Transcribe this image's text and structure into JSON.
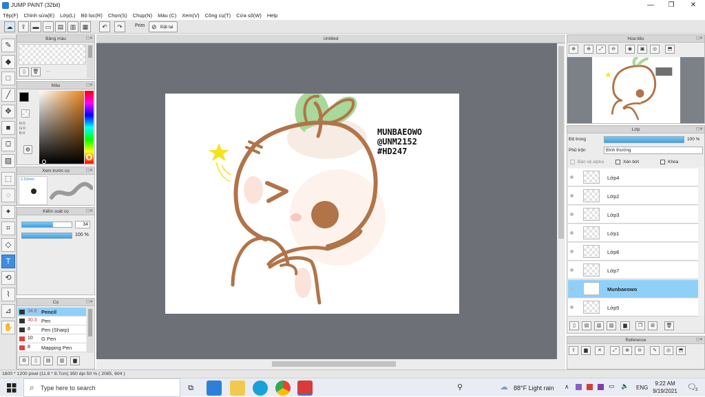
{
  "window": {
    "title": "JUMP PAINT (32bit)",
    "min": "—",
    "max": "❐",
    "close": "✕"
  },
  "menu": [
    "Tệp(F)",
    "Chỉnh sửa(E)",
    "Lớp(L)",
    "Bộ lọc(R)",
    "Chọn(S)",
    "Chụp(N)",
    "Màu (C)",
    "Xem(V)",
    "Công cụ(T)",
    "Cửa sổ(W)",
    "Help"
  ],
  "toolbar": {
    "prim_label": "Prim",
    "reset_label": "Đặt lại"
  },
  "panels": {
    "palette": {
      "title": "Bảng màu",
      "hint": "---"
    },
    "color": {
      "title": "Màu",
      "r": "R:0",
      "g": "G:0",
      "b": "B:0",
      "current": "#000000"
    },
    "preview": {
      "title": "Xem trước cọ",
      "size": "2.53mm"
    },
    "control": {
      "title": "Kiểm soát cọ",
      "size_value": "34",
      "opacity_value": "100 %"
    },
    "brushes": {
      "title": "Cọ",
      "items": [
        {
          "size": "34.6",
          "name": "Pencil",
          "color": "#333333"
        },
        {
          "size": "30.3",
          "name": "Pen",
          "color": "#333333"
        },
        {
          "size": "8",
          "name": "Pen (Sharp)",
          "color": "#333333"
        },
        {
          "size": "10",
          "name": "G Pen",
          "color": "#e04040"
        },
        {
          "size": "8",
          "name": "Mapping Pen",
          "color": "#e04040"
        }
      ]
    },
    "navigator": {
      "title": "Hoa tiêu"
    },
    "layers": {
      "title": "Lớp",
      "opacity_label": "Độ trong",
      "opacity_value": "100 %",
      "opacity_fraction": 1.0,
      "blend_label": "Phủ trộn",
      "blend_value": "Bình thường",
      "protect_alpha": "Bảo vệ alpha",
      "clip": "Xén bớt",
      "lock": "Khóa",
      "items": [
        "Lớp4",
        "Lớp2",
        "Lớp3",
        "Lớp1",
        "Lớp6",
        "Lớp7",
        "Munbaeowo",
        "Lớp5"
      ],
      "selected_index": 6
    },
    "reference": {
      "title": "Reference"
    }
  },
  "document": {
    "tab": "Untitled"
  },
  "artwork": {
    "caption_lines": [
      "MUNBAEOWO",
      "@UNM2152",
      "#HD247"
    ]
  },
  "status": {
    "text": "1600 * 1200 pixel   (11.6 * 8.7cm)   350 dpi   50 %   ( 2085, 604 )"
  },
  "taskbar": {
    "search_placeholder": "Type here to search",
    "weather": "88°F  Light rain",
    "lang": "ENG",
    "time": "9:22 AM",
    "date": "9/19/2021",
    "notif_count": "3"
  }
}
